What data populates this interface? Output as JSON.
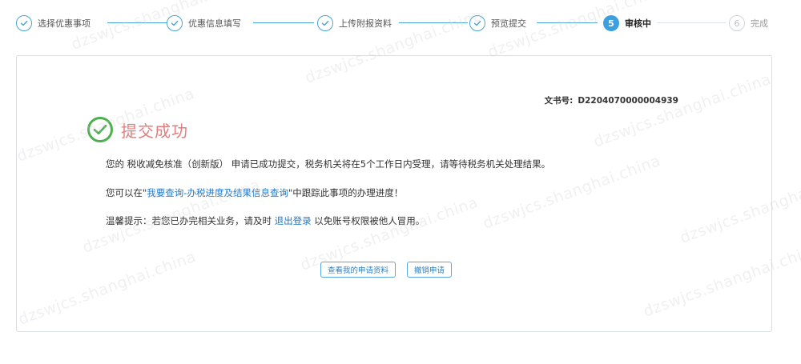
{
  "steps": [
    {
      "num": "",
      "label": "选择优惠事项",
      "state": "done"
    },
    {
      "num": "",
      "label": "优惠信息填写",
      "state": "done"
    },
    {
      "num": "",
      "label": "上传附报资料",
      "state": "done"
    },
    {
      "num": "",
      "label": "预览提交",
      "state": "done"
    },
    {
      "num": "5",
      "label": "审核中",
      "state": "active"
    },
    {
      "num": "6",
      "label": "完成",
      "state": "todo"
    }
  ],
  "doc": {
    "label": "文书号:",
    "number": "D2204070000004939"
  },
  "success": {
    "title": "提交成功"
  },
  "message1": {
    "prefix": "您的 ",
    "item": "税收减免核准（创新版）",
    "suffix": " 申请已成功提交，税务机关将在5个工作日内受理，请等待税务机关处理结果。"
  },
  "message2": {
    "prefix": "您可以在\"",
    "link": "我要查询-办税进度及结果信息查询",
    "suffix": "\"中跟踪此事项的办理进度！"
  },
  "message3": {
    "prefix": "温馨提示：若您已办完相关业务，请及时 ",
    "link": "退出登录",
    "suffix": " 以免账号权限被他人冒用。"
  },
  "buttons": {
    "view": "查看我的申请资料",
    "revoke": "撤销申请"
  },
  "watermark": "dzswjcs.shanghai.china",
  "colors": {
    "accent": "#3c9fe0",
    "success": "#4caf50",
    "title": "#e47c7c",
    "link": "#1f78c8"
  }
}
